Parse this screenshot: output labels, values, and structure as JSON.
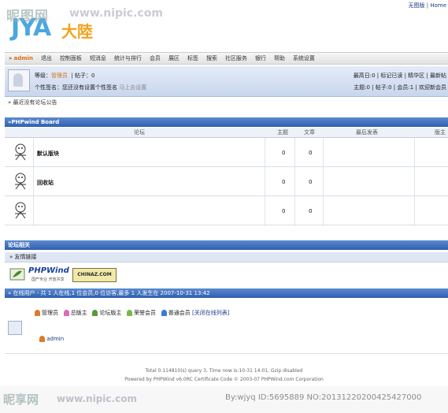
{
  "watermark": {
    "top_cn": "昵图网",
    "top_url": "www.nipic.com",
    "bottom_cn": "昵享网",
    "bottom_url": "www.nipic.com",
    "id": "By:wjyq ID:5695889 NO:20131220200425427000"
  },
  "logo": {
    "latin": "JYA",
    "cn": "大陸"
  },
  "top_links": {
    "no_image": "无图版",
    "home": "Home"
  },
  "nav": {
    "user": "admin",
    "items": [
      "退出",
      "控制面板",
      "短消息",
      "统计与排行",
      "会员",
      "展区",
      "标签",
      "搜索",
      "社区服务",
      "银行",
      "帮助",
      "系统设置"
    ]
  },
  "userpanel": {
    "level_label": "等级：",
    "level_value": "管理员",
    "posts_label": "帖子：0",
    "sig_label": "个性签名：您还没有设置个性签名",
    "sig_link": "马上去设置",
    "right1": "最高日:0 | 标记已读 | 精华区 | 最新帖",
    "right2": "主题:0 | 帖子:0 | 会员:1 | 欢迎新会员"
  },
  "notice": "最近没有论坛公告",
  "board": {
    "title": "»PHPwind Board",
    "headers": {
      "forum": "论坛",
      "topics": "主题",
      "posts": "文章",
      "last": "最后发表",
      "mod": "版主"
    },
    "rows": [
      {
        "name": "默认版块",
        "topics": "0",
        "posts": "0"
      },
      {
        "name": "回收站",
        "topics": "0",
        "posts": "0"
      },
      {
        "name": "",
        "topics": "0",
        "posts": "0"
      }
    ]
  },
  "related": {
    "title": "论坛相关",
    "links_label": "友情链接",
    "phpwind": "PHPWind",
    "phpwind_tag": "国产专业 开放共享",
    "chinaz": "CHINAZ.COM"
  },
  "online": {
    "header": "在线用户 - 共 1 人在线,1 位会员,0 位访客,最多 1 人发生在 2007-10-31 13:42",
    "legend": [
      "管理员",
      "总版主",
      "论坛版主",
      "荣誉会员",
      "普通会员"
    ],
    "close_link": "[关闭在线列表]",
    "user": "admin"
  },
  "footer": {
    "line1": "Total 0.114810(s) query 3, Time now is:10-31 14:01, Gzip disabled",
    "line2": "Powered by PHPWind v6.0RC Certificate Code © 2003-07 PHPWind.com Corporation"
  },
  "colors": {
    "header_blue": "#2f5fae",
    "accent_orange": "#d5720c",
    "admin_badge": "#e07a2a",
    "supermod_badge": "#e06ab8",
    "mod_badge": "#5a9a3a",
    "honor_badge": "#7ab84a",
    "member_badge": "#3a7ad8"
  }
}
